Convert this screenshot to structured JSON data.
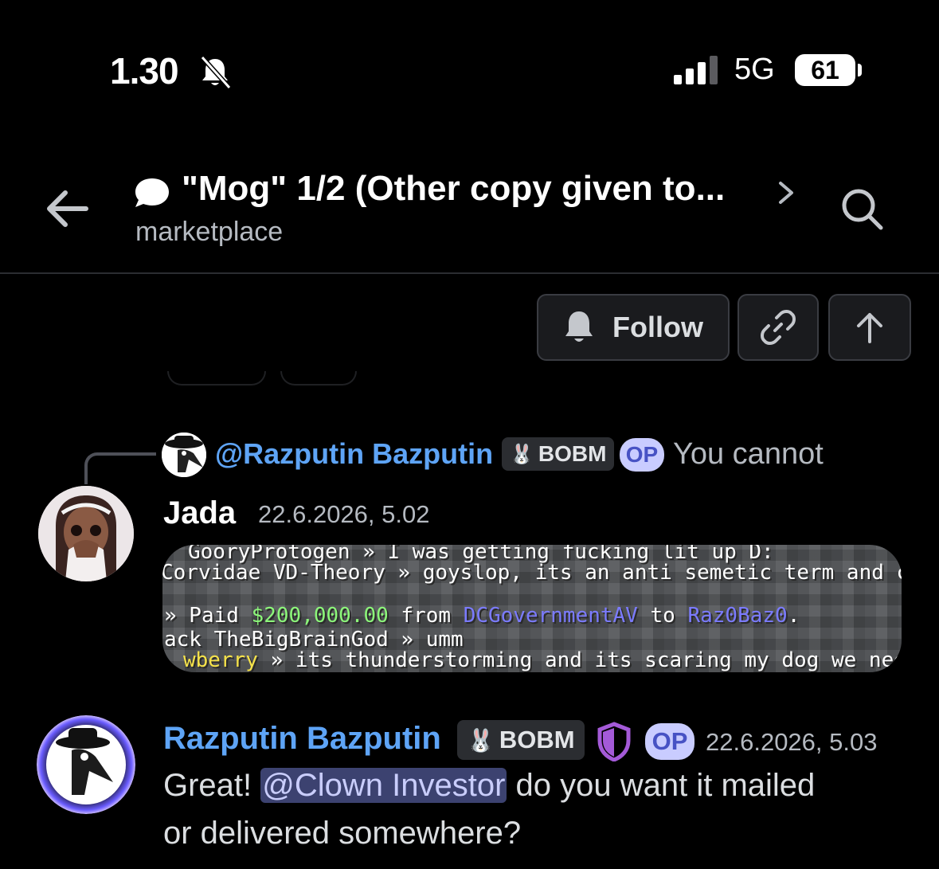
{
  "status_bar": {
    "time": "1.30",
    "network": "5G",
    "battery": "61"
  },
  "header": {
    "title": "\"Mog\" 1/2 (Other copy given to...",
    "channel": "marketplace"
  },
  "actions": {
    "follow_label": "Follow"
  },
  "reply_preview": {
    "mention": "@Razputin Bazputin",
    "tag": "BOBM",
    "op": "OP",
    "snippet": "You cannot"
  },
  "messages": [
    {
      "author": "Jada",
      "timestamp": "22.6.2026, 5.02",
      "attachment_lines": {
        "l1": "GooryProtogen » I was getting fucking lit up D:",
        "l2": "Corvidae VD-Theory » goyslop, its an anti semetic term and cor",
        "l3_prefix": "» Paid ",
        "l3_amount": "$200,000.00",
        "l3_mid": " from ",
        "l3_from": "DCGovernmentAV",
        "l3_to_word": " to ",
        "l3_to": "Raz0Baz0",
        "l3_end": ".",
        "l4": "ack TheBigBrainGod » umm",
        "l5_name": "wberry",
        "l5_text": " » its thunderstorming and its scaring my dog we nee"
      }
    },
    {
      "author": "Razputin Bazputin",
      "tag": "BOBM",
      "op": "OP",
      "timestamp": "22.6.2026, 5.03",
      "text_before": "Great! ",
      "mention": "@Clown Investor",
      "text_after": " do you want it mailed",
      "text_line2": "or delivered somewhere?"
    }
  ],
  "colors": {
    "background": "#000000",
    "link_blue": "#5ea4f6",
    "op_badge_bg": "#c9ccff",
    "op_badge_text": "#4752c4",
    "mention_bg": "#3c4270",
    "shield_purple": "#a45ad8"
  }
}
